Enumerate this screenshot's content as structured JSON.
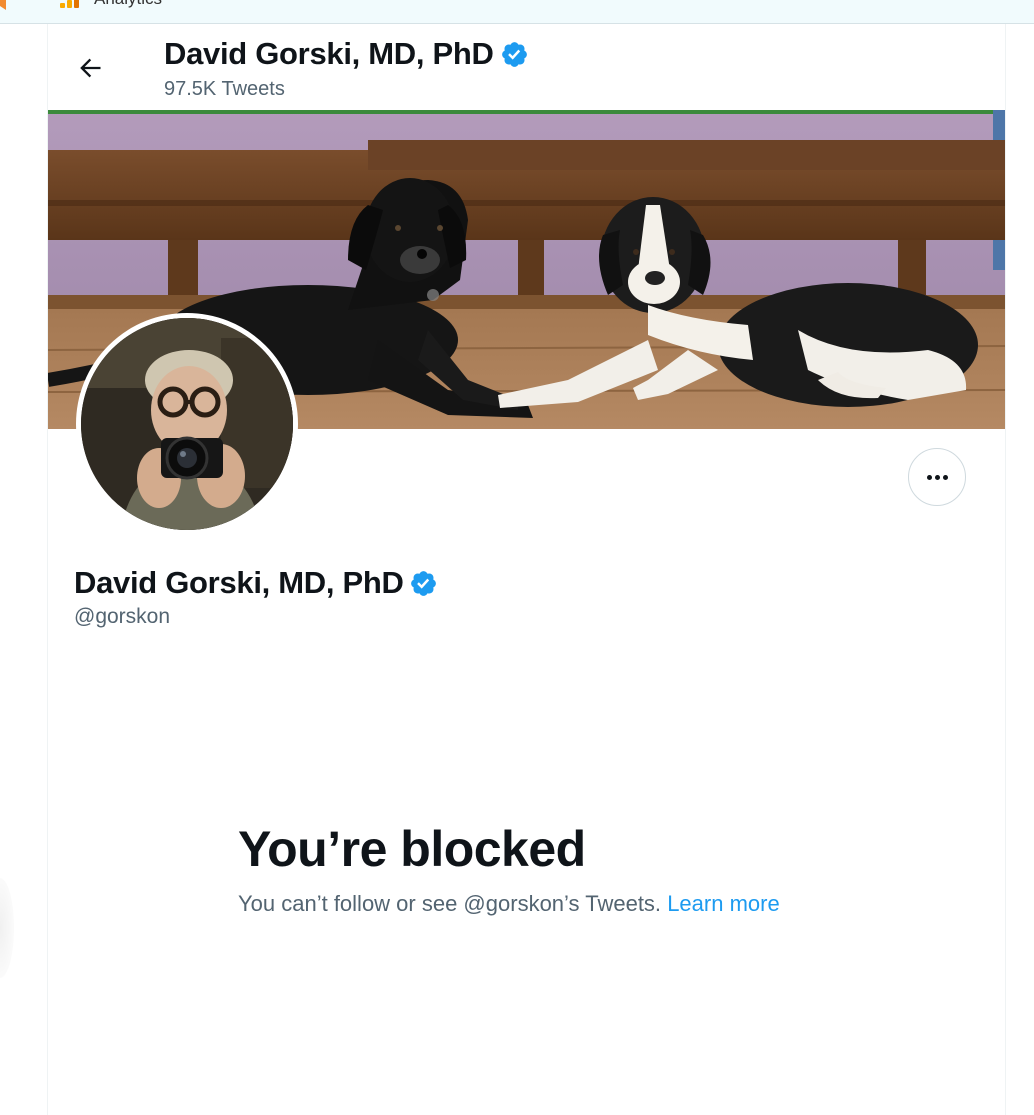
{
  "browser": {
    "bookmark_label": "Analytics"
  },
  "header": {
    "name": "David Gorski, MD, PhD",
    "tweet_count": "97.5K Tweets"
  },
  "profile": {
    "name": "David Gorski, MD, PhD",
    "handle": "@gorskon"
  },
  "blocked": {
    "title": "You’re blocked",
    "message": "You can’t follow or see @gorskon’s Tweets.",
    "link_label": "Learn more"
  },
  "icons": {
    "back": "arrow-left-icon",
    "verified": "verified-badge-icon",
    "more": "more-horizontal-icon",
    "analytics": "analytics-bars-icon"
  },
  "colors": {
    "accent": "#1d9bf0",
    "text_primary": "#0f1419",
    "text_secondary": "#536471",
    "border": "#cfd9de",
    "bookmarks_bg": "#f1fbfd"
  }
}
